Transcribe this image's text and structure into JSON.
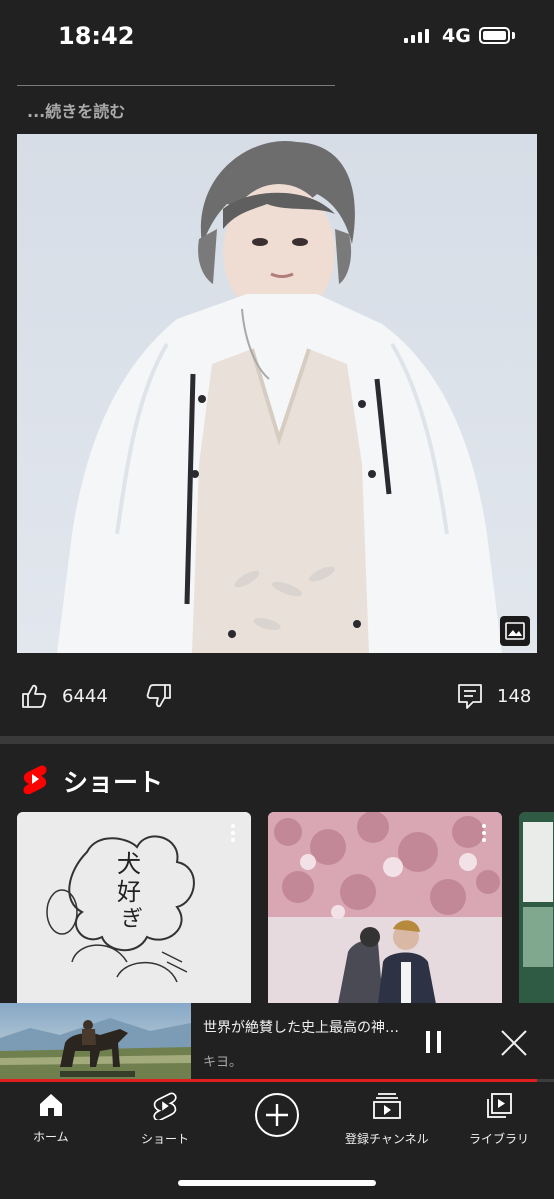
{
  "status_bar": {
    "time": "18:42",
    "network": "4G"
  },
  "post": {
    "read_more": "...続きを読む",
    "likes": "6444",
    "comments": "148"
  },
  "shorts": {
    "title": "ショート"
  },
  "mini_player": {
    "title": "世界が絶賛した史上最高の神…",
    "channel": "キヨ。",
    "progress": 0.97
  },
  "nav": {
    "home": "ホーム",
    "shorts": "ショート",
    "subscriptions": "登録チャンネル",
    "library": "ライブラリ"
  },
  "colors": {
    "accent": "#e21f1f",
    "background": "#212121"
  }
}
